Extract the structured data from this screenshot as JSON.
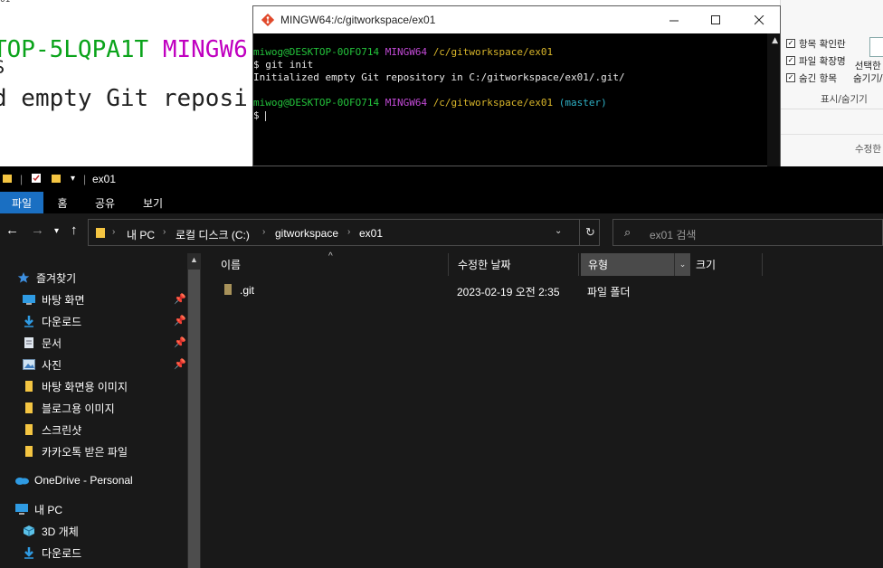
{
  "background_window": {
    "tiny_text": "01",
    "line1_green": "TOP-5LQPA1T",
    "line1_magenta": "MINGW6",
    "line2": "$",
    "line3": "d empty Git reposi"
  },
  "ribbon_fragment": {
    "checkboxes": [
      {
        "label": "항목 확인란",
        "checked": true
      },
      {
        "label": "파일 확장명",
        "checked": true
      },
      {
        "label": "숨긴 항목",
        "checked": true
      }
    ],
    "selected_hide_line1": "선택한",
    "selected_hide_line2": "숨기기/",
    "group_label": "표시/숨기기",
    "column_header": "수정한"
  },
  "terminal": {
    "title": "MINGW64:/c/gitworkspace/ex01",
    "lines": [
      [
        {
          "t": "miwog@DESKTOP-0OFO714 ",
          "c": "c-green"
        },
        {
          "t": "MINGW64 ",
          "c": "c-mag"
        },
        {
          "t": "/c/gitworkspace/ex01",
          "c": "c-yel"
        }
      ],
      [
        {
          "t": "$ git init",
          "c": "c-white"
        }
      ],
      [
        {
          "t": "Initialized empty Git repository in C:/gitworkspace/ex01/.git/",
          "c": "c-white"
        }
      ],
      [
        {
          "t": "",
          "c": "c-white"
        }
      ],
      [
        {
          "t": "miwog@DESKTOP-0OFO714 ",
          "c": "c-green"
        },
        {
          "t": "MINGW64 ",
          "c": "c-mag"
        },
        {
          "t": "/c/gitworkspace/ex01 ",
          "c": "c-yel"
        },
        {
          "t": "(master)",
          "c": "c-cyan"
        }
      ],
      [
        {
          "t": "$ ",
          "c": "c-white"
        }
      ]
    ]
  },
  "explorer": {
    "title": "ex01",
    "ribbon_tabs": {
      "file": "파일",
      "home": "홈",
      "share": "공유",
      "view": "보기"
    },
    "breadcrumb": [
      "내 PC",
      "로컬 디스크 (C:)",
      "gitworkspace",
      "ex01"
    ],
    "search_placeholder": "ex01 검색",
    "nav": {
      "quick_access": "즐겨찾기",
      "desktop": "바탕 화면",
      "downloads": "다운로드",
      "documents": "문서",
      "pictures": "사진",
      "wallpaper_images": "바탕 화면용 이미지",
      "blog_images": "블로그용 이미지",
      "screenshots": "스크린샷",
      "kakaotalk_files": "카카오톡 받은 파일",
      "onedrive": "OneDrive - Personal",
      "this_pc": "내 PC",
      "objects_3d": "3D 개체",
      "pc_downloads": "다운로드"
    },
    "columns": {
      "name": "이름",
      "date": "수정한 날짜",
      "type": "유형",
      "size": "크기"
    },
    "files": [
      {
        "name": ".git",
        "date": "2023-02-19 오전 2:35",
        "type": "파일 폴더",
        "size": ""
      }
    ]
  },
  "colors": {
    "terminal_bg": "#000000",
    "explorer_bg": "#191919",
    "accent": "#1a6fc2",
    "folder_yellow": "#f4c542"
  }
}
